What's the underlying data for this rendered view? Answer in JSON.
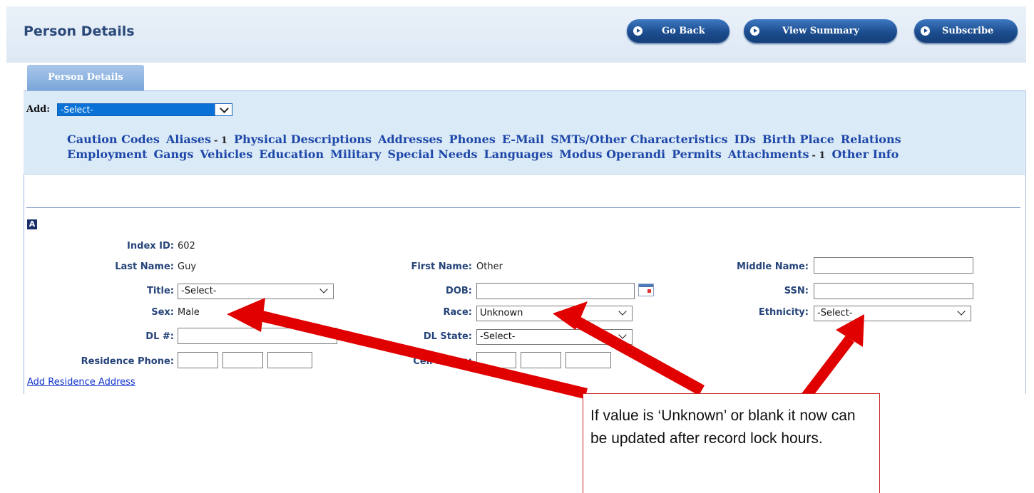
{
  "header": {
    "title": "Person Details",
    "buttons": [
      "Go Back",
      "View Summary",
      "Subscribe"
    ]
  },
  "tab": "Person Details",
  "add_bar": {
    "label": "Add:",
    "selected": "-Select-"
  },
  "links_row1": [
    {
      "label": "Caution Codes"
    },
    {
      "label": "Aliases",
      "count": "- 1"
    },
    {
      "label": "Physical Descriptions"
    },
    {
      "label": "Addresses"
    },
    {
      "label": "Phones"
    },
    {
      "label": "E-Mail"
    },
    {
      "label": "SMTs/Other Characteristics"
    },
    {
      "label": "IDs"
    },
    {
      "label": "Birth Place"
    },
    {
      "label": "Relations"
    }
  ],
  "links_row2": [
    {
      "label": "Employment"
    },
    {
      "label": "Gangs"
    },
    {
      "label": "Vehicles"
    },
    {
      "label": "Education"
    },
    {
      "label": "Military"
    },
    {
      "label": "Special Needs"
    },
    {
      "label": "Languages"
    },
    {
      "label": "Modus Operandi"
    },
    {
      "label": "Permits"
    },
    {
      "label": "Attachments",
      "count": "- 1"
    },
    {
      "label": "Other Info"
    }
  ],
  "section": {
    "title": {
      "label": "Title:",
      "value": "-Select-"
    },
    "icon": "A",
    "index_id": {
      "label": "Index ID:",
      "value": "602"
    },
    "last_name": {
      "label": "Last Name:",
      "value": "Guy"
    },
    "first_name": {
      "label": "First Name:",
      "value": "Other"
    },
    "middle_name": {
      "label": "Middle Name:",
      "value": ""
    },
    "dob": {
      "label": "DOB:",
      "value": ""
    },
    "ssn": {
      "label": "SSN:",
      "value": ""
    },
    "sex": {
      "label": "Sex:",
      "value": "Male"
    },
    "race": {
      "label": "Race:",
      "value": "Unknown"
    },
    "ethnicity": {
      "label": "Ethnicity:",
      "value": "-Select-"
    },
    "dl_number": {
      "label": "DL #:",
      "value": ""
    },
    "dl_state": {
      "label": "DL State:",
      "value": "-Select-"
    },
    "residence_phone": {
      "label": "Residence Phone:"
    },
    "cell_phone": {
      "label": "Cell Phone:"
    },
    "add_residence_link": "Add Residence Address"
  },
  "callout": {
    "text": "If value is ‘Unknown’ or blank it now can be updated after record lock hours.",
    "color": "#e00000"
  }
}
